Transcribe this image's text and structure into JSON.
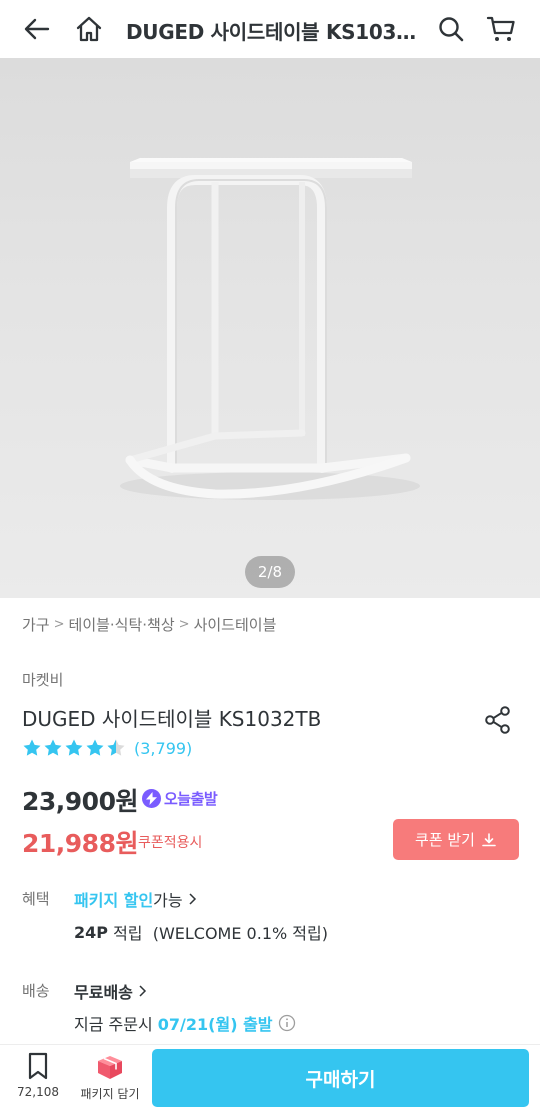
{
  "header": {
    "title": "DUGED 사이드테이블 KS1032TB",
    "icons": [
      "back-arrow-icon",
      "home-icon",
      "search-icon",
      "cart-icon"
    ]
  },
  "gallery": {
    "page_indicator": "2/8"
  },
  "breadcrumb": [
    "가구",
    "테이블·식탁·책상",
    "사이드테이블"
  ],
  "product": {
    "brand": "마켓비",
    "name": "DUGED 사이드테이블 KS1032TB",
    "rating": 4.5,
    "review_count": "(3,799)",
    "original_price": "23,900원",
    "delivery_badge": "오늘출발",
    "sale_price": "21,988원",
    "coupon_note": "쿠폰적용시",
    "coupon_button": "쿠폰 받기"
  },
  "benefit": {
    "label": "혜택",
    "package_highlight": "패키지 할인",
    "package_rest": " 가능",
    "points": "24P",
    "points_rest": " 적립  (WELCOME 0.1% 적립)"
  },
  "shipping": {
    "label": "배송",
    "type": "무료배송",
    "order_prefix": "지금 주문시 ",
    "ship_date": "07/21(월) 출발"
  },
  "bottom_bar": {
    "bookmark_count": "72,108",
    "package_label": "패키지 담기",
    "buy_label": "구매하기"
  },
  "colors": {
    "accent": "#35c5f0",
    "sale": "#e85c5c",
    "coupon_button": "#f77b7b",
    "delivery_badge": "#7a5cff"
  }
}
